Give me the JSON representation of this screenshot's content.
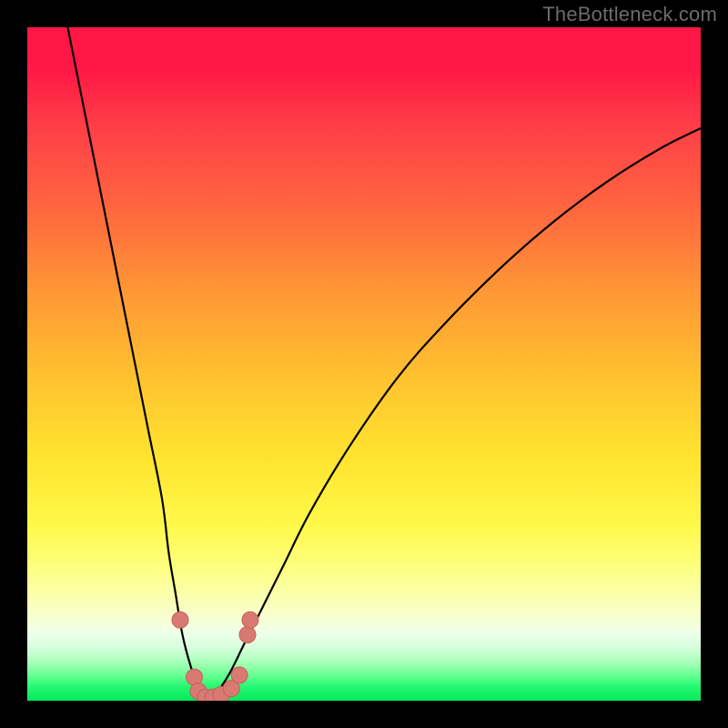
{
  "watermark": "TheBottleneck.com",
  "colors": {
    "frame": "#000000",
    "curve": "#000000",
    "marker_fill": "#d87a72",
    "marker_stroke": "#c46058"
  },
  "chart_data": {
    "type": "line",
    "title": "",
    "xlabel": "",
    "ylabel": "",
    "xlim": [
      0,
      100
    ],
    "ylim": [
      0,
      100
    ],
    "grid": false,
    "legend": false,
    "notes": "V-shaped bottleneck curve; y ≈ percent bottleneck vs an unlabeled x-axis. Background hue encodes severity (green ≈ 0%, red ≈ 100%). Values estimated from pixel positions.",
    "series": [
      {
        "name": "left-branch",
        "x": [
          6,
          8,
          10,
          12,
          14,
          16,
          18,
          20,
          21,
          22,
          23,
          24,
          25,
          26,
          27
        ],
        "y": [
          100,
          90,
          80,
          70,
          60,
          50,
          40,
          30,
          22,
          16,
          10,
          6,
          3,
          1.2,
          0.3
        ]
      },
      {
        "name": "right-branch",
        "x": [
          27,
          28,
          30,
          32,
          34,
          38,
          42,
          48,
          55,
          62,
          70,
          78,
          86,
          94,
          100
        ],
        "y": [
          0.3,
          1,
          4,
          8,
          12,
          20,
          28,
          38,
          48,
          56,
          64,
          71,
          77,
          82,
          85
        ]
      }
    ],
    "markers": [
      {
        "x": 22.7,
        "y": 12.0
      },
      {
        "x": 24.8,
        "y": 3.5
      },
      {
        "x": 25.4,
        "y": 1.4
      },
      {
        "x": 26.5,
        "y": 0.5
      },
      {
        "x": 27.6,
        "y": 0.5
      },
      {
        "x": 28.8,
        "y": 0.9
      },
      {
        "x": 30.3,
        "y": 1.8
      },
      {
        "x": 31.5,
        "y": 3.8
      },
      {
        "x": 32.7,
        "y": 9.8
      },
      {
        "x": 33.1,
        "y": 12.0
      }
    ]
  }
}
